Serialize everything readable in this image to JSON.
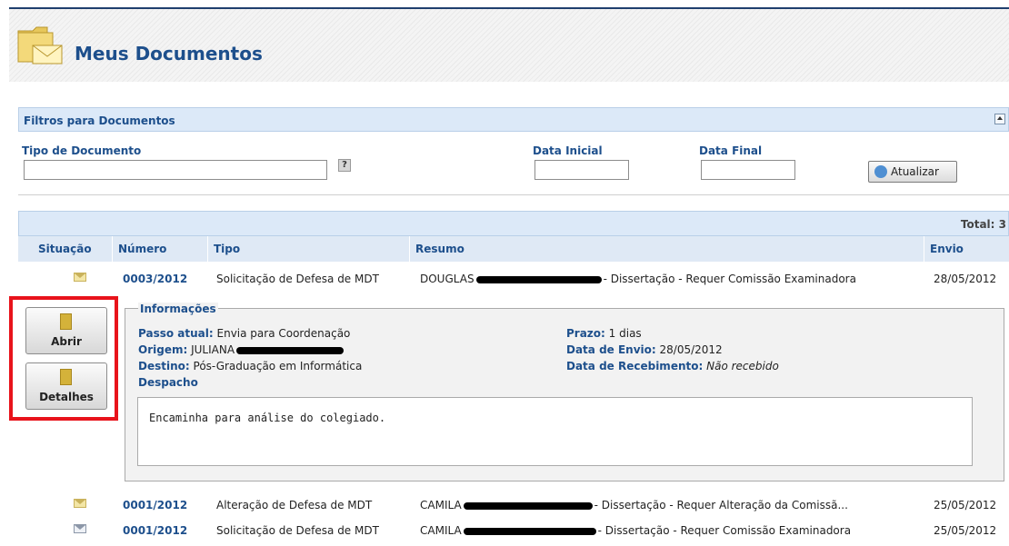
{
  "header": {
    "title": "Meus Documentos"
  },
  "filters": {
    "title": "Filtros para Documentos",
    "tipo_label": "Tipo de Documento",
    "tipo_value": "",
    "help_glyph": "?",
    "data_inicial_label": "Data Inicial",
    "data_inicial_value": "",
    "data_final_label": "Data Final",
    "data_final_value": "",
    "refresh_label": "Atualizar"
  },
  "table": {
    "total": "Total: 3",
    "columns": [
      "Situação",
      "Número",
      "Tipo",
      "Resumo",
      "Envio"
    ],
    "rows": [
      {
        "numero": "0003/2012",
        "tipo": "Solicitação de Defesa de MDT",
        "resumo_name": "DOUGLAS",
        "resumo_rest": "- Dissertação - Requer Comissão Examinadora",
        "envio": "28/05/2012"
      },
      {
        "numero": "0001/2012",
        "tipo": "Alteração de Defesa de MDT",
        "resumo_name": "CAMILA",
        "resumo_rest": "- Dissertação - Requer Alteração da Comissã...",
        "envio": "25/05/2012"
      },
      {
        "numero": "0001/2012",
        "tipo": "Solicitação de Defesa de MDT",
        "resumo_name": "CAMILA",
        "resumo_rest": "- Dissertação - Requer Comissão Examinadora",
        "envio": "25/05/2012"
      }
    ]
  },
  "actions": {
    "abrir": "Abrir",
    "detalhes": "Detalhes"
  },
  "info": {
    "legend": "Informações",
    "passo_label": "Passo atual:",
    "passo_value": "Envia para Coordenação",
    "origem_label": "Origem:",
    "origem_value": "JULIANA",
    "destino_label": "Destino:",
    "destino_value": "Pós-Graduação em Informática",
    "despacho_label": "Despacho",
    "prazo_label": "Prazo:",
    "prazo_value": "1 dias",
    "envio_label": "Data de Envio:",
    "envio_value": "28/05/2012",
    "recebimento_label": "Data de Recebimento:",
    "recebimento_value": "Não recebido",
    "despacho_text": "Encaminha para análise do colegiado."
  },
  "icons": [
    "folder-mail-icon",
    "help-icon",
    "refresh-icon",
    "envelope-icon",
    "envelope-open-icon",
    "open-doc-icon",
    "details-doc-icon"
  ]
}
